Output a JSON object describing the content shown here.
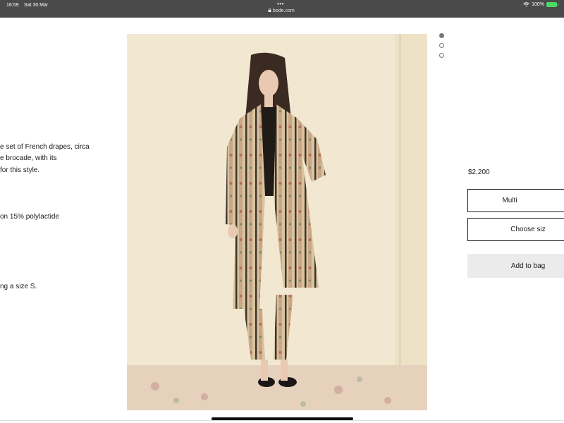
{
  "status_bar": {
    "time": "16:59",
    "date": "Sat 30 Mar",
    "url": "bode.com",
    "battery": "100%"
  },
  "description": {
    "lines": [
      "e set of French drapes, circa",
      "e brocade, with its",
      " for this style.",
      "on 15% polylactide",
      "ng a size S."
    ]
  },
  "carousel": {
    "count": 3,
    "active": 0
  },
  "product": {
    "price": "$2,200",
    "color_select": "Multi",
    "size_select": "Choose siz",
    "add_to_bag": "Add to bag"
  },
  "colors": {
    "statusbar": "#4a4a4a",
    "image_background": "#f3ead4",
    "add_button_bg": "#ebebeb"
  }
}
